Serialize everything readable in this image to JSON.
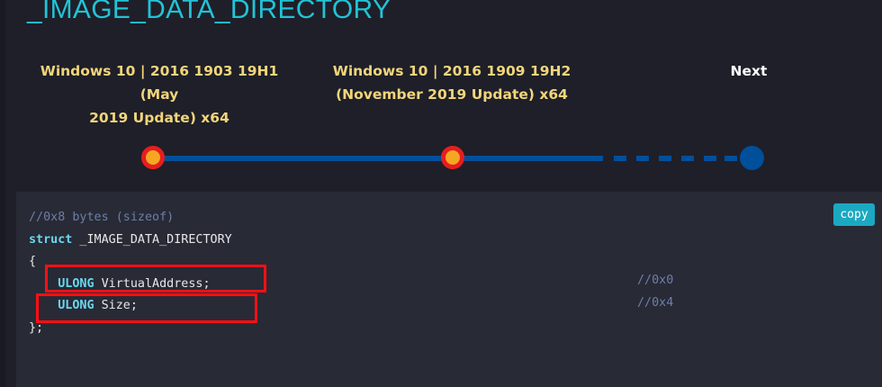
{
  "page": {
    "title": "_IMAGE_DATA_DIRECTORY"
  },
  "timeline": {
    "versions": [
      {
        "line1": "Windows 10 | 2016 1903 19H1 (May",
        "line2": "2019 Update) x64"
      },
      {
        "line1": "Windows 10 | 2016 1909 19H2",
        "line2": "(November 2019 Update) x64"
      }
    ],
    "next_label": "Next"
  },
  "code": {
    "size_comment": "//0x8 bytes (sizeof)",
    "struct_keyword": "struct",
    "struct_name": " _IMAGE_DATA_DIRECTORY",
    "open_brace": "{",
    "fields": [
      {
        "type": "ULONG",
        "name": " VirtualAddress;",
        "offset": "//0x0"
      },
      {
        "type": "ULONG",
        "name": " Size;",
        "offset": "//0x4"
      }
    ],
    "close_brace": "};",
    "copy_label": "copy"
  },
  "colors": {
    "title": "#22c3d6",
    "version_text": "#f2d57a",
    "timeline_line": "#004f9a",
    "dot_border": "#e61e1e",
    "dot_fill": "#f5a623",
    "keyword": "#66d9ef",
    "comment": "#6d7fa8",
    "copy_button": "#1ba9c2",
    "highlight_box": "#ff0f14"
  }
}
